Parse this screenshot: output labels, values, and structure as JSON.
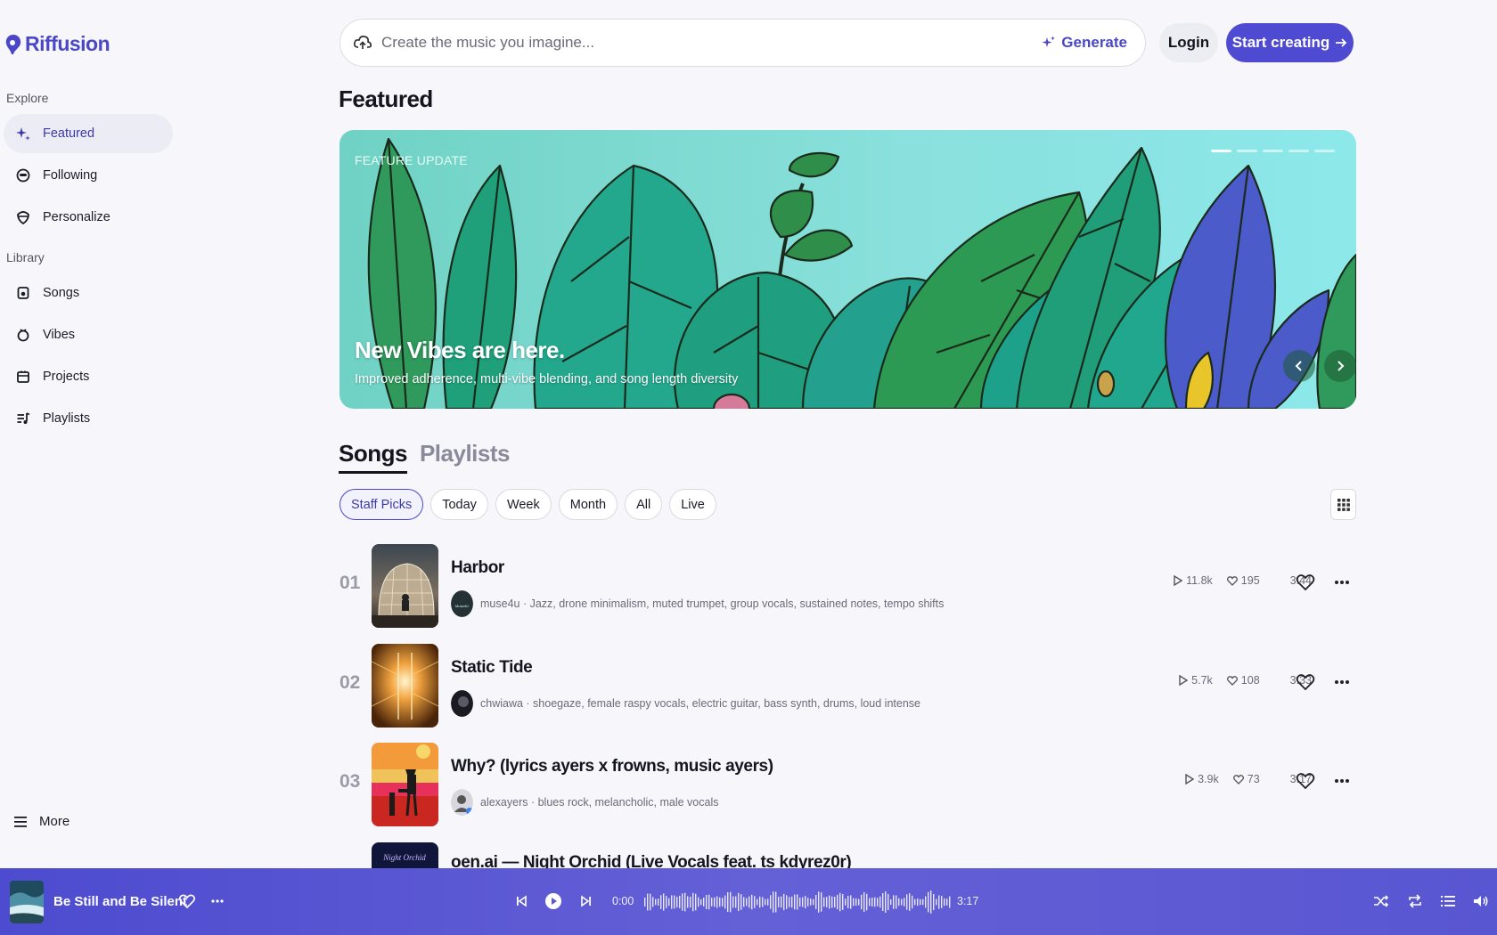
{
  "app": {
    "name": "Riffusion"
  },
  "sidebar": {
    "explore_label": "Explore",
    "explore_items": [
      {
        "label": "Featured",
        "icon": "sparkle-icon",
        "active": true
      },
      {
        "label": "Following",
        "icon": "following-icon"
      },
      {
        "label": "Personalize",
        "icon": "personalize-icon"
      }
    ],
    "library_label": "Library",
    "library_items": [
      {
        "label": "Songs",
        "icon": "song-icon"
      },
      {
        "label": "Vibes",
        "icon": "vibe-icon"
      },
      {
        "label": "Projects",
        "icon": "project-icon"
      },
      {
        "label": "Playlists",
        "icon": "playlist-icon"
      }
    ],
    "more_label": "More"
  },
  "search": {
    "placeholder": "Create the music you imagine...",
    "generate_label": "Generate"
  },
  "header": {
    "login_label": "Login",
    "start_label": "Start creating"
  },
  "page_title": "Featured",
  "banner": {
    "eyebrow": "FEATURE UPDATE",
    "headline": "New Vibes are here.",
    "subtitle": "Improved adherence, multi-vibe blending, and song length diversity",
    "slide_count": 6,
    "active_slide": 1
  },
  "tabs": [
    {
      "label": "Songs",
      "active": true
    },
    {
      "label": "Playlists"
    }
  ],
  "filters": [
    {
      "label": "Staff Picks",
      "active": true
    },
    {
      "label": "Today"
    },
    {
      "label": "Week"
    },
    {
      "label": "Month"
    },
    {
      "label": "All"
    },
    {
      "label": "Live"
    }
  ],
  "songs": [
    {
      "rank": "01",
      "title": "Harbor",
      "meta": "muse4u · Jazz, drone minimalism, muted trumpet, group vocals, sustained notes, tempo shifts",
      "avatar_text": "Muse4U",
      "plays": "11.8k",
      "likes": "195",
      "duration": "3:44"
    },
    {
      "rank": "02",
      "title": "Static Tide",
      "meta": "chwiawa · shoegaze, female raspy vocals, electric guitar, bass synth, drums, loud intense",
      "plays": "5.7k",
      "likes": "108",
      "duration": "3:33"
    },
    {
      "rank": "03",
      "title": "Why? (lyrics ayers x frowns, music ayers)",
      "meta": "alexayers · blues rock, melancholic, male vocals",
      "plays": "3.9k",
      "likes": "73",
      "duration": "3:17"
    },
    {
      "rank": "04",
      "title": "oen.ai — Night Orchid (Live Vocals feat. ts kdyrez0r)",
      "cover_text": "Night Orchid"
    }
  ],
  "player": {
    "title": "Be Still and Be Silent",
    "current_time": "0:00",
    "total_time": "3:17"
  },
  "colors": {
    "accent": "#4e4ad2",
    "player_bg": "#5956d2"
  }
}
